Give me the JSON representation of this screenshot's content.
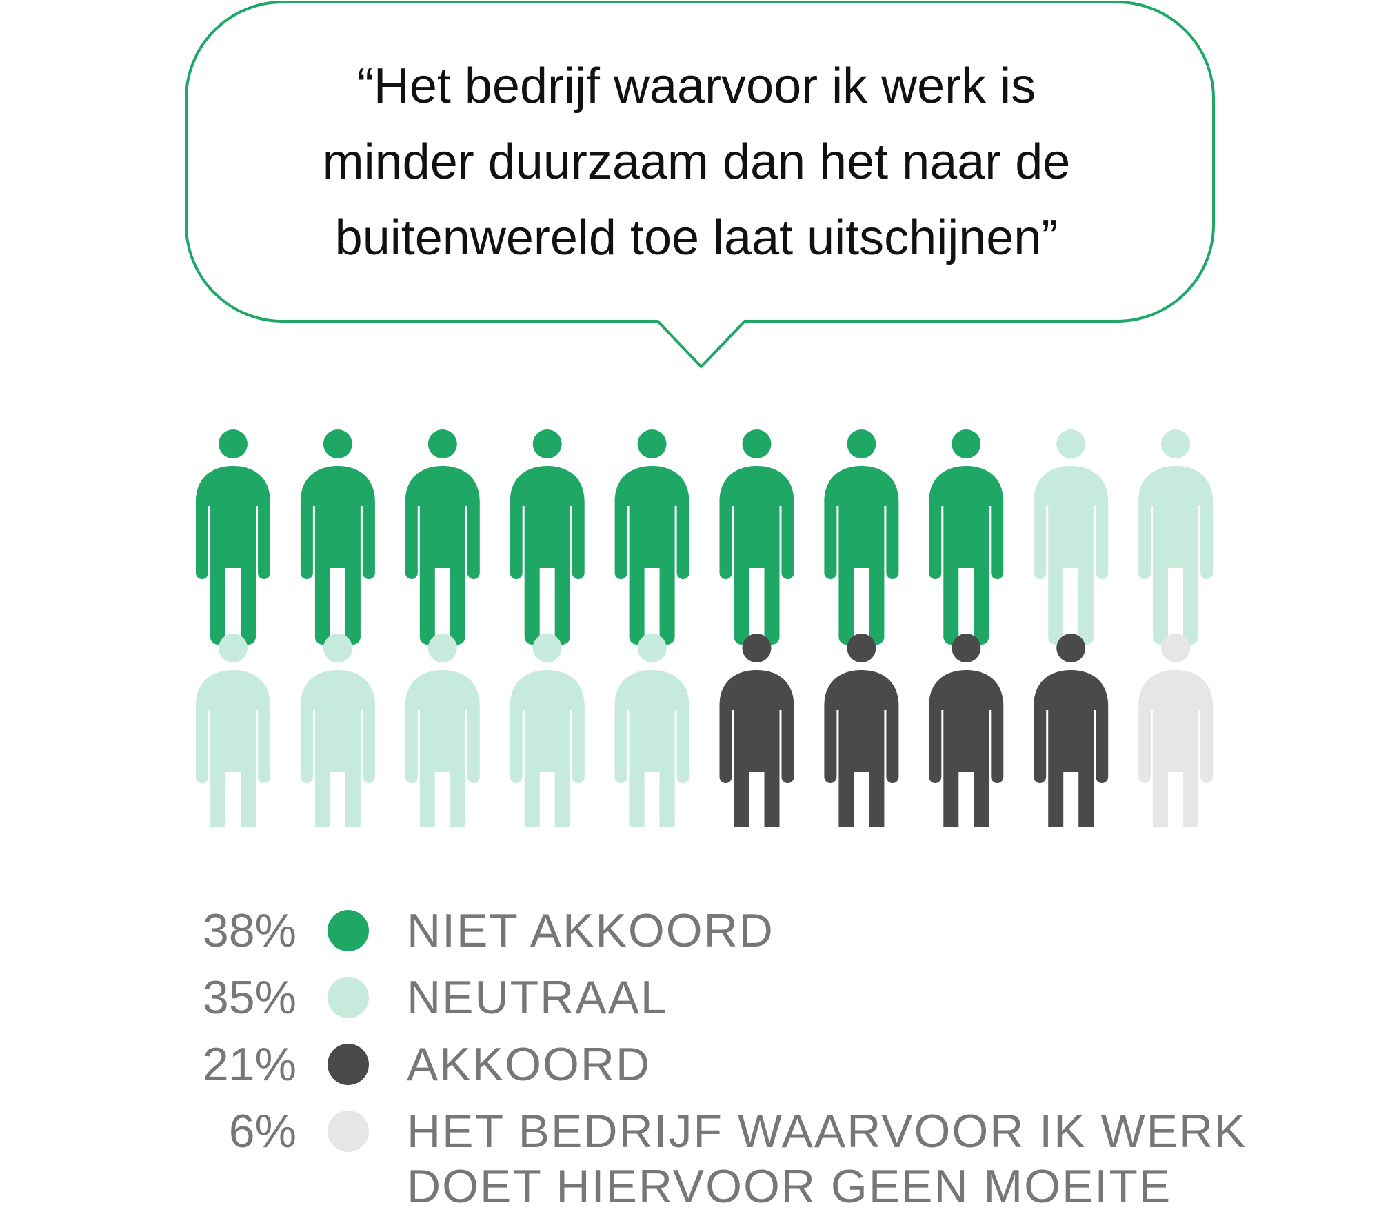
{
  "quote": {
    "lines": [
      "“Het bedrijf waarvoor ik werk is",
      "minder duurzaam dan het naar de",
      "buitenwereld toe laat uitschijnen”"
    ]
  },
  "colors": {
    "bubble_border": "#1fa766",
    "niet_akkoord": "#1fa766",
    "neutraal": "#c6eadb",
    "akkoord": "#4a4a4a",
    "geen_moeite": "#e6e6e6",
    "legend_text": "#777777"
  },
  "icons": {
    "person": "person-icon",
    "legend_marker": "circle-icon"
  },
  "chart_data": {
    "type": "pictogram",
    "icons_total": 20,
    "series": [
      {
        "name": "NIET AKKOORD",
        "value": 38,
        "label": "38%",
        "icons": 8,
        "color": "#1fa766"
      },
      {
        "name": "NEUTRAAL",
        "value": 35,
        "label": "35%",
        "icons": 7,
        "color": "#c6eadb"
      },
      {
        "name": "AKKOORD",
        "value": 21,
        "label": "21%",
        "icons": 4,
        "color": "#4a4a4a"
      },
      {
        "name": "HET BEDRIJF WAARVOOR IK WERK DOET HIERVOOR GEEN MOEITE",
        "value": 6,
        "label": "6%",
        "icons": 1,
        "color": "#e6e6e6",
        "label_lines": [
          "HET BEDRIJF WAARVOOR IK WERK",
          "DOET HIERVOOR GEEN MOEITE"
        ]
      }
    ]
  }
}
